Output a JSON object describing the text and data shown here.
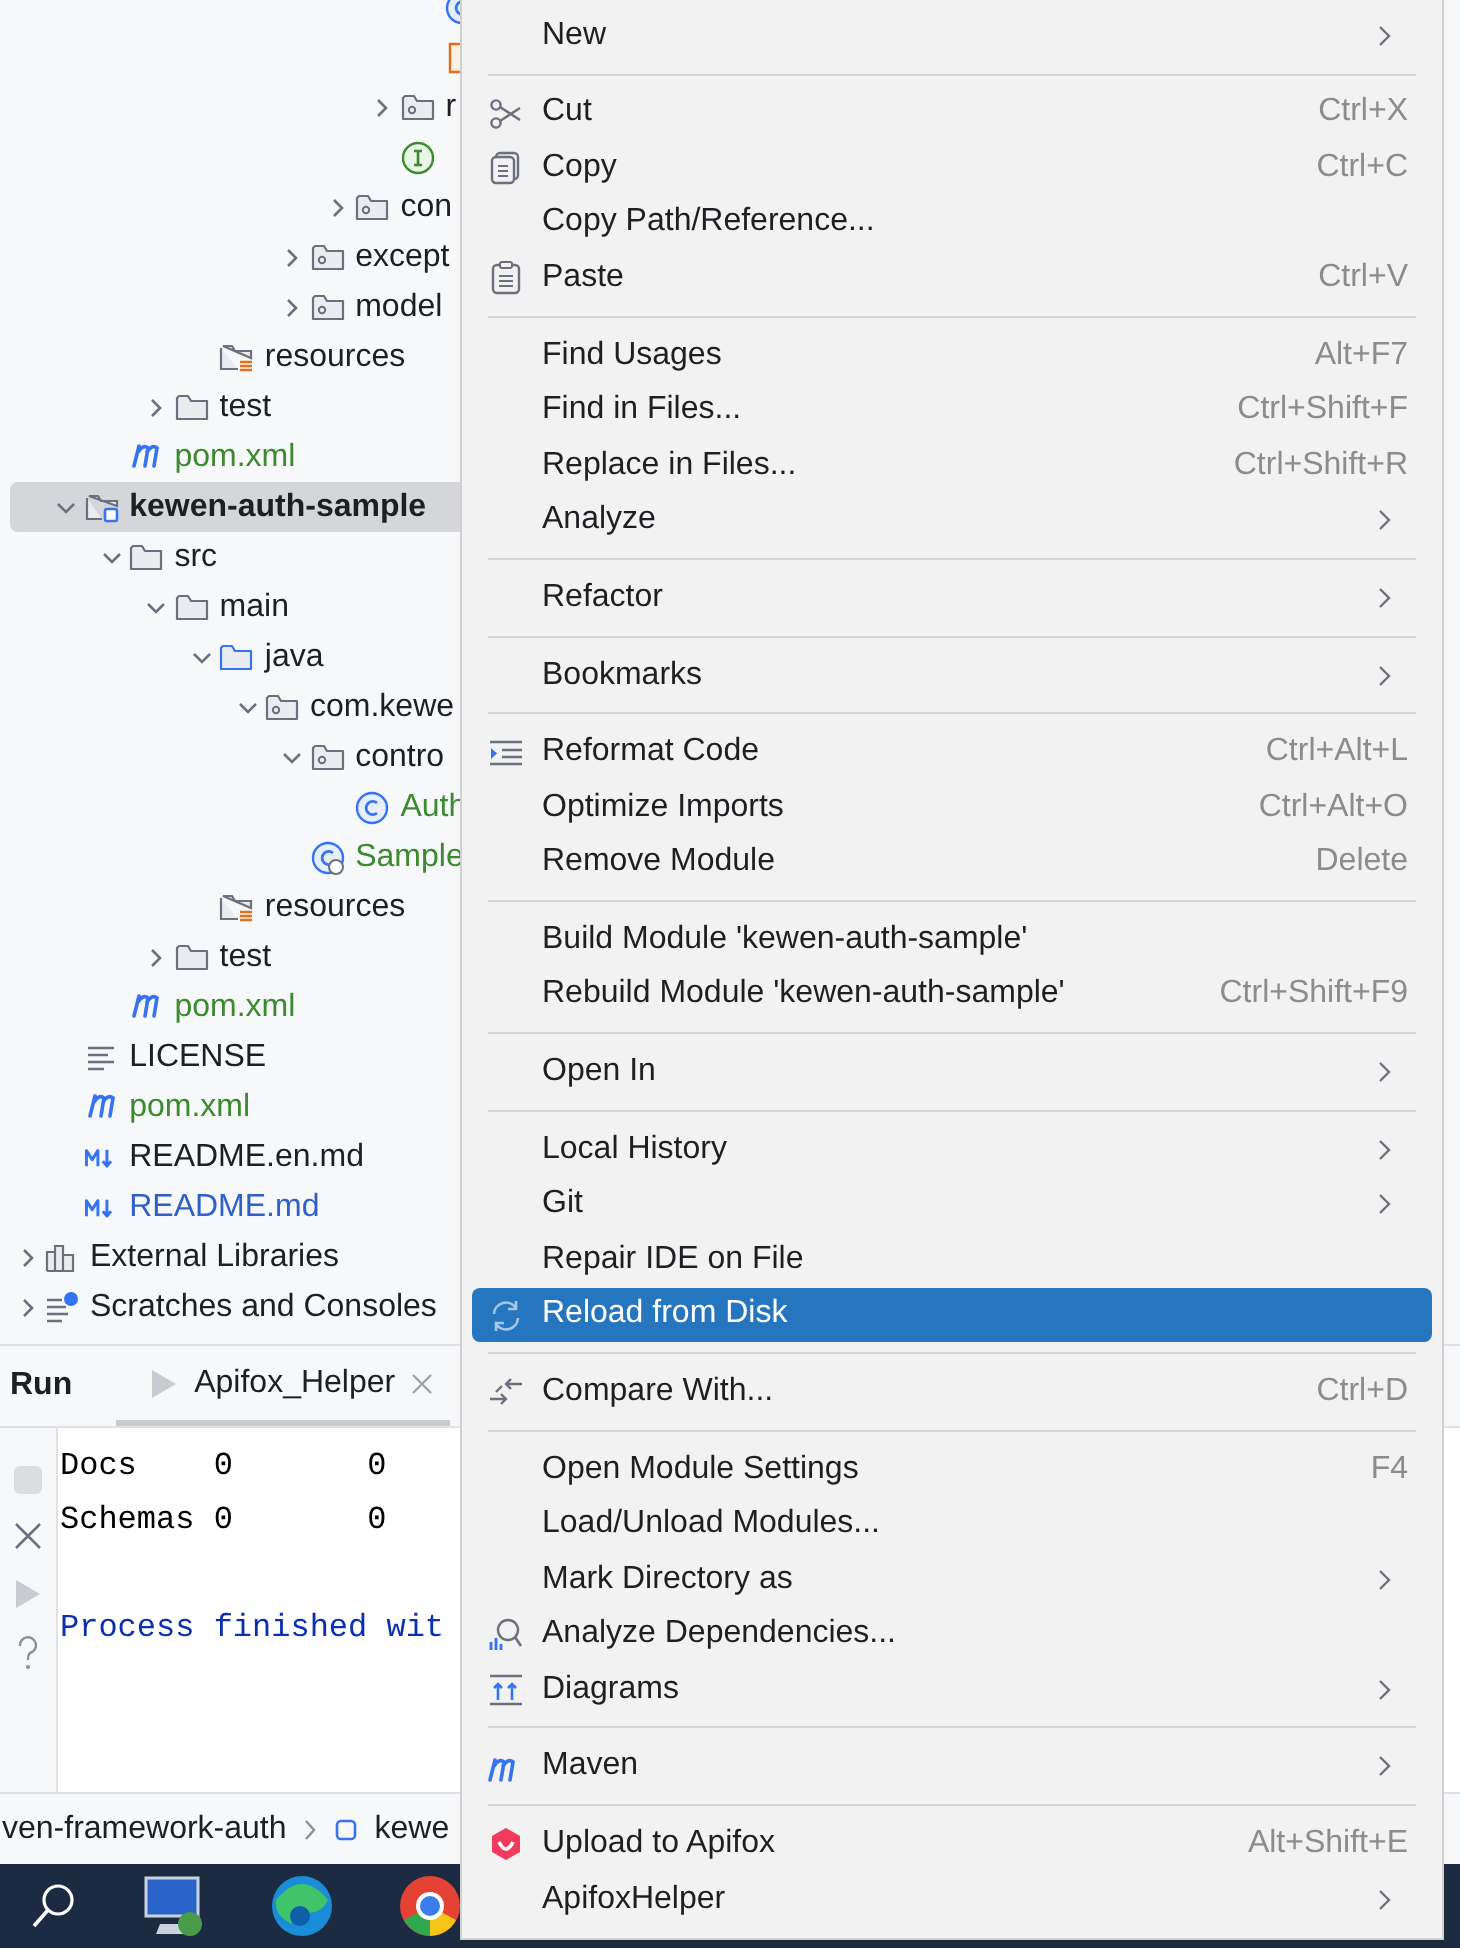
{
  "tree": {
    "items": [
      {
        "children": [
          {
            "children": [
              {
                "children": [
                  {
                    "children": [
                      {
                        "children": [
                          {
                            "children": [
                              {
                                "children": [
                                  {
                                    "children": [
                                      {
                                        "children": [
                                          {
                                            "kind": "class"
                                          },
                                          {
                                            "kind": "resource-file"
                                          }
                                        ]
                                      },
                                      {
                                        "kind": "package",
                                        "label": "r",
                                        "expanded": false,
                                        "selected": false
                                      },
                                      {
                                        "kind": "interface"
                                      }
                                    ]
                                  },
                                  {
                                    "kind": "package",
                                    "label": "con",
                                    "expanded": false,
                                    "selected": false
                                  }
                                ]
                              },
                              {
                                "kind": "package",
                                "label": "except",
                                "expanded": false,
                                "selected": false
                              },
                              {
                                "kind": "package",
                                "label": "model",
                                "expanded": false,
                                "selected": false
                              }
                            ]
                          }
                        ]
                      },
                      {
                        "kind": "resources",
                        "label": "resources",
                        "selected": false
                      }
                    ]
                  },
                  {
                    "kind": "folder",
                    "label": "test",
                    "expanded": false,
                    "selected": false
                  }
                ]
              },
              {
                "kind": "maven",
                "label": "pom.xml",
                "color": "#3c8a2e",
                "selected": false
              }
            ]
          },
          {
            "kind": "module",
            "label": "kewen-auth-sample",
            "expanded": true,
            "selected": true,
            "children": [
              {
                "kind": "folder",
                "label": "src",
                "expanded": true,
                "selected": false,
                "children": [
                  {
                    "kind": "folder",
                    "label": "main",
                    "expanded": true,
                    "selected": false,
                    "children": [
                      {
                        "kind": "source-root",
                        "label": "java",
                        "expanded": true,
                        "selected": false,
                        "children": [
                          {
                            "kind": "package",
                            "label": "com.kewe",
                            "expanded": true,
                            "selected": false,
                            "children": [
                              {
                                "kind": "package",
                                "label": "contro",
                                "expanded": true,
                                "selected": false,
                                "children": [
                                  {
                                    "kind": "class",
                                    "label": "Auth",
                                    "color": "#3c8a2e",
                                    "selected": false
                                  }
                                ]
                              },
                              {
                                "kind": "class-run",
                                "label": "Sample",
                                "color": "#3c8a2e",
                                "selected": false
                              }
                            ]
                          }
                        ]
                      },
                      {
                        "kind": "resources",
                        "label": "resources",
                        "selected": false
                      }
                    ]
                  },
                  {
                    "kind": "folder",
                    "label": "test",
                    "expanded": false,
                    "selected": false
                  }
                ]
              },
              {
                "kind": "maven",
                "label": "pom.xml",
                "color": "#3c8a2e",
                "selected": false
              }
            ]
          },
          {
            "kind": "text",
            "label": "LICENSE",
            "selected": false
          },
          {
            "kind": "maven",
            "label": "pom.xml",
            "color": "#3c8a2e",
            "selected": false
          },
          {
            "kind": "markdown",
            "label": "README.en.md",
            "selected": false
          },
          {
            "kind": "markdown",
            "label": "README.md",
            "color": "#2f5fc9",
            "selected": false
          }
        ]
      },
      {
        "kind": "libraries",
        "label": "External Libraries",
        "expanded": false,
        "selected": false
      },
      {
        "kind": "scratches",
        "label": "Scratches and Consoles",
        "expanded": false,
        "selected": false
      }
    ]
  },
  "run_panel": {
    "title": "Run",
    "tabs": [
      {
        "label": "Apifox_Helper",
        "selected": true
      }
    ],
    "console": [
      {
        "kind": "output",
        "text": "Docs    0       0"
      },
      {
        "kind": "output",
        "text": "Schemas 0       0"
      },
      {
        "kind": "blank"
      },
      {
        "kind": "system",
        "text": "Process finished wit"
      }
    ]
  },
  "breadcrumbs": [
    {
      "kind": "text",
      "label": "ven-framework-auth"
    },
    {
      "kind": "module",
      "label": "kewe"
    }
  ],
  "context_menu": [
    {
      "kind": "item",
      "label": "New",
      "submenu": true,
      "selected": false
    },
    {
      "kind": "separator"
    },
    {
      "kind": "cut",
      "label": "Cut",
      "shortcut": "Ctrl+X",
      "selected": false
    },
    {
      "kind": "copy",
      "label": "Copy",
      "shortcut": "Ctrl+C",
      "selected": false
    },
    {
      "kind": "item",
      "label": "Copy Path/Reference...",
      "selected": false
    },
    {
      "kind": "paste",
      "label": "Paste",
      "shortcut": "Ctrl+V",
      "selected": false
    },
    {
      "kind": "separator"
    },
    {
      "kind": "item",
      "label": "Find Usages",
      "shortcut": "Alt+F7",
      "selected": false
    },
    {
      "kind": "item",
      "label": "Find in Files...",
      "shortcut": "Ctrl+Shift+F",
      "selected": false
    },
    {
      "kind": "item",
      "label": "Replace in Files...",
      "shortcut": "Ctrl+Shift+R",
      "selected": false
    },
    {
      "kind": "item",
      "label": "Analyze",
      "submenu": true,
      "selected": false
    },
    {
      "kind": "separator"
    },
    {
      "kind": "item",
      "label": "Refactor",
      "submenu": true,
      "selected": false
    },
    {
      "kind": "separator"
    },
    {
      "kind": "item",
      "label": "Bookmarks",
      "submenu": true,
      "selected": false
    },
    {
      "kind": "separator"
    },
    {
      "kind": "reformat",
      "label": "Reformat Code",
      "shortcut": "Ctrl+Alt+L",
      "selected": false
    },
    {
      "kind": "item",
      "label": "Optimize Imports",
      "shortcut": "Ctrl+Alt+O",
      "selected": false
    },
    {
      "kind": "item",
      "label": "Remove Module",
      "shortcut": "Delete",
      "selected": false
    },
    {
      "kind": "separator"
    },
    {
      "kind": "item",
      "label": "Build Module 'kewen-auth-sample'",
      "selected": false
    },
    {
      "kind": "item",
      "label": "Rebuild Module 'kewen-auth-sample'",
      "shortcut": "Ctrl+Shift+F9",
      "selected": false
    },
    {
      "kind": "separator"
    },
    {
      "kind": "item",
      "label": "Open In",
      "submenu": true,
      "selected": false
    },
    {
      "kind": "separator"
    },
    {
      "kind": "item",
      "label": "Local History",
      "submenu": true,
      "selected": false
    },
    {
      "kind": "item",
      "label": "Git",
      "submenu": true,
      "selected": false
    },
    {
      "kind": "item",
      "label": "Repair IDE on File",
      "selected": false
    },
    {
      "kind": "reload",
      "label": "Reload from Disk",
      "selected": true
    },
    {
      "kind": "separator"
    },
    {
      "kind": "compare",
      "label": "Compare With...",
      "shortcut": "Ctrl+D",
      "selected": false
    },
    {
      "kind": "separator"
    },
    {
      "kind": "item",
      "label": "Open Module Settings",
      "shortcut": "F4",
      "selected": false
    },
    {
      "kind": "item",
      "label": "Load/Unload Modules...",
      "selected": false
    },
    {
      "kind": "item",
      "label": "Mark Directory as",
      "submenu": true,
      "selected": false
    },
    {
      "kind": "dependencies",
      "label": "Analyze Dependencies...",
      "selected": false
    },
    {
      "kind": "diagrams",
      "label": "Diagrams",
      "submenu": true,
      "selected": false
    },
    {
      "kind": "separator"
    },
    {
      "kind": "maven",
      "label": "Maven",
      "submenu": true,
      "selected": false
    },
    {
      "kind": "separator"
    },
    {
      "kind": "apifox",
      "label": "Upload to Apifox",
      "shortcut": "Alt+Shift+E",
      "selected": false
    },
    {
      "kind": "item",
      "label": "ApifoxHelper",
      "submenu": true,
      "selected": false
    }
  ]
}
